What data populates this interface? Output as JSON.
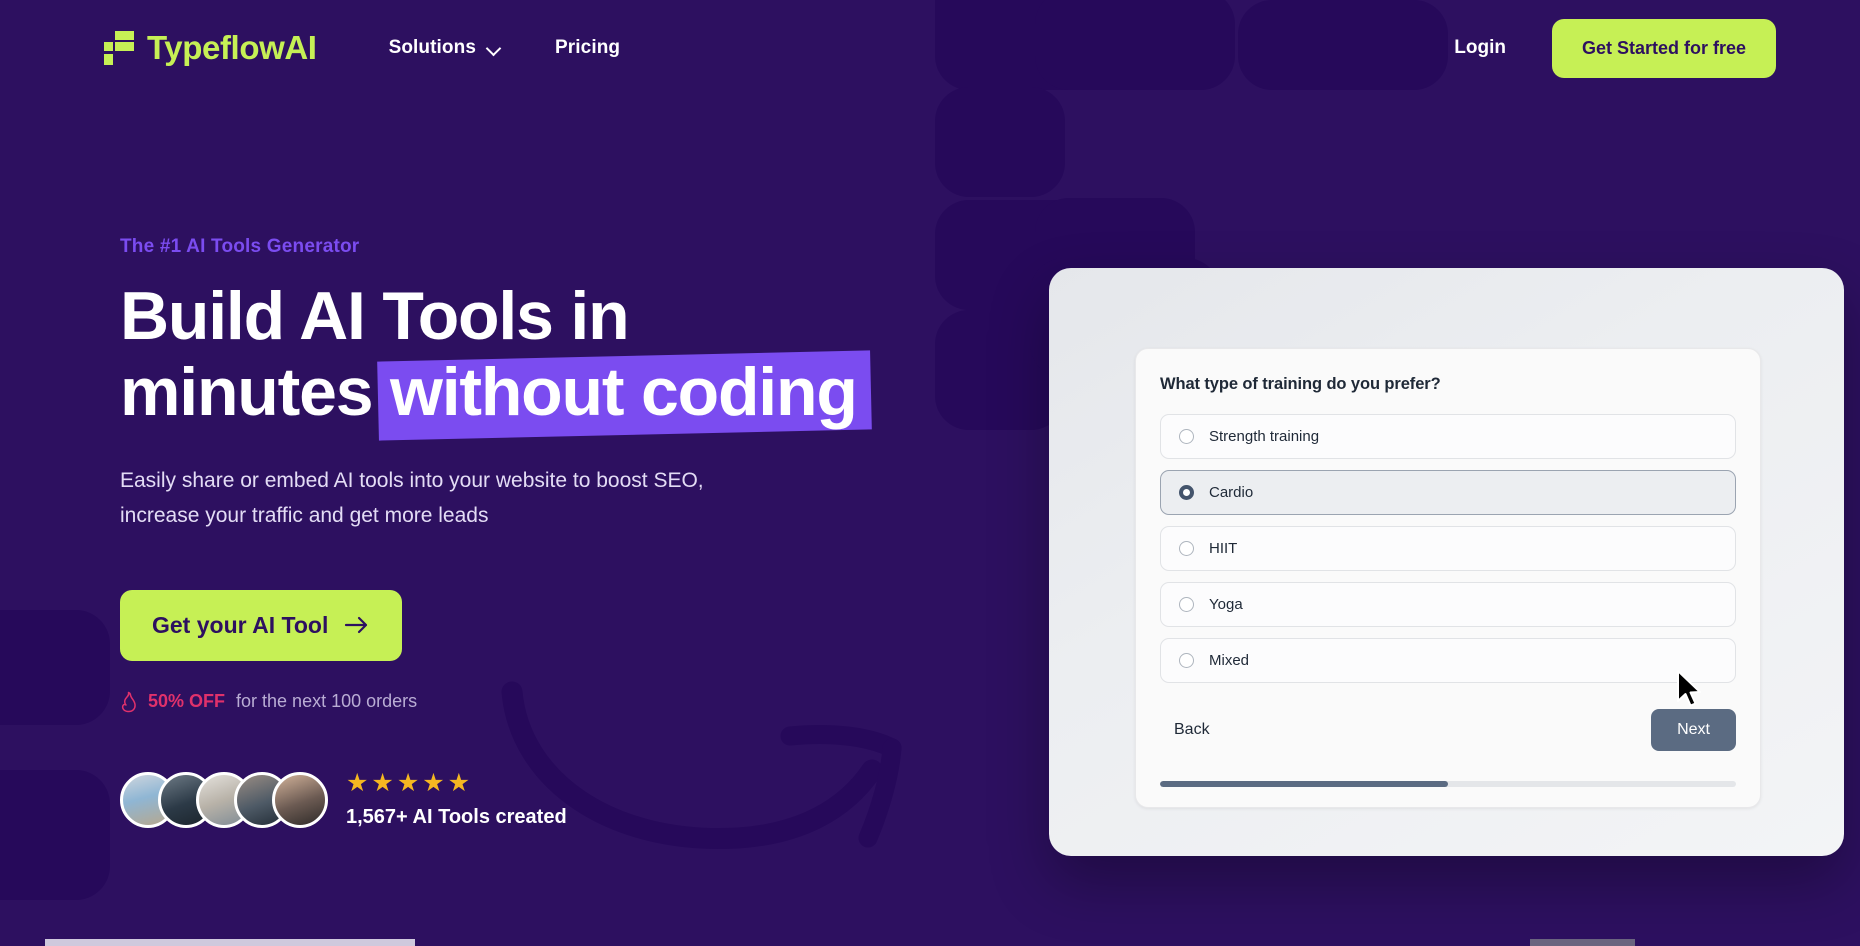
{
  "brand": {
    "name": "TypeflowAI",
    "logo_icon": "typeflow-f-mark"
  },
  "nav": {
    "items": [
      {
        "label": "Solutions",
        "has_dropdown": true,
        "icon": "chevron-down-icon"
      },
      {
        "label": "Pricing",
        "has_dropdown": false
      }
    ],
    "login_label": "Login",
    "cta_label": "Get Started for free"
  },
  "hero": {
    "eyebrow": "The #1 AI Tools Generator",
    "headline_line1": "Build AI Tools in",
    "headline_line2_plain": "minutes ",
    "headline_line2_highlight": "without coding",
    "subheadline": "Easily share or embed AI tools into your website to boost SEO, increase your traffic and get more leads",
    "cta_label": "Get your AI Tool",
    "cta_icon": "arrow-right-icon",
    "offer_icon": "flame-icon",
    "offer_highlight": "50% OFF",
    "offer_rest": "for the next 100 orders"
  },
  "social_proof": {
    "avatar_count": 5,
    "stars": "★★★★★",
    "rating_value": 5,
    "count_label": "1,567+ AI Tools created"
  },
  "widget": {
    "question": "What type of training do you prefer?",
    "options": [
      {
        "label": "Strength training",
        "selected": false
      },
      {
        "label": "Cardio",
        "selected": true
      },
      {
        "label": "HIIT",
        "selected": false
      },
      {
        "label": "Yoga",
        "selected": false
      },
      {
        "label": "Mixed",
        "selected": false
      }
    ],
    "back_label": "Back",
    "next_label": "Next",
    "progress_percent": 50
  },
  "colors": {
    "background": "#2d1060",
    "background_block": "#26095a",
    "accent_green": "#c6f055",
    "accent_purple": "#7b4cf0",
    "offer_pink": "#e0316b",
    "star_gold": "#f5b721",
    "widget_button": "#5b6b82"
  }
}
